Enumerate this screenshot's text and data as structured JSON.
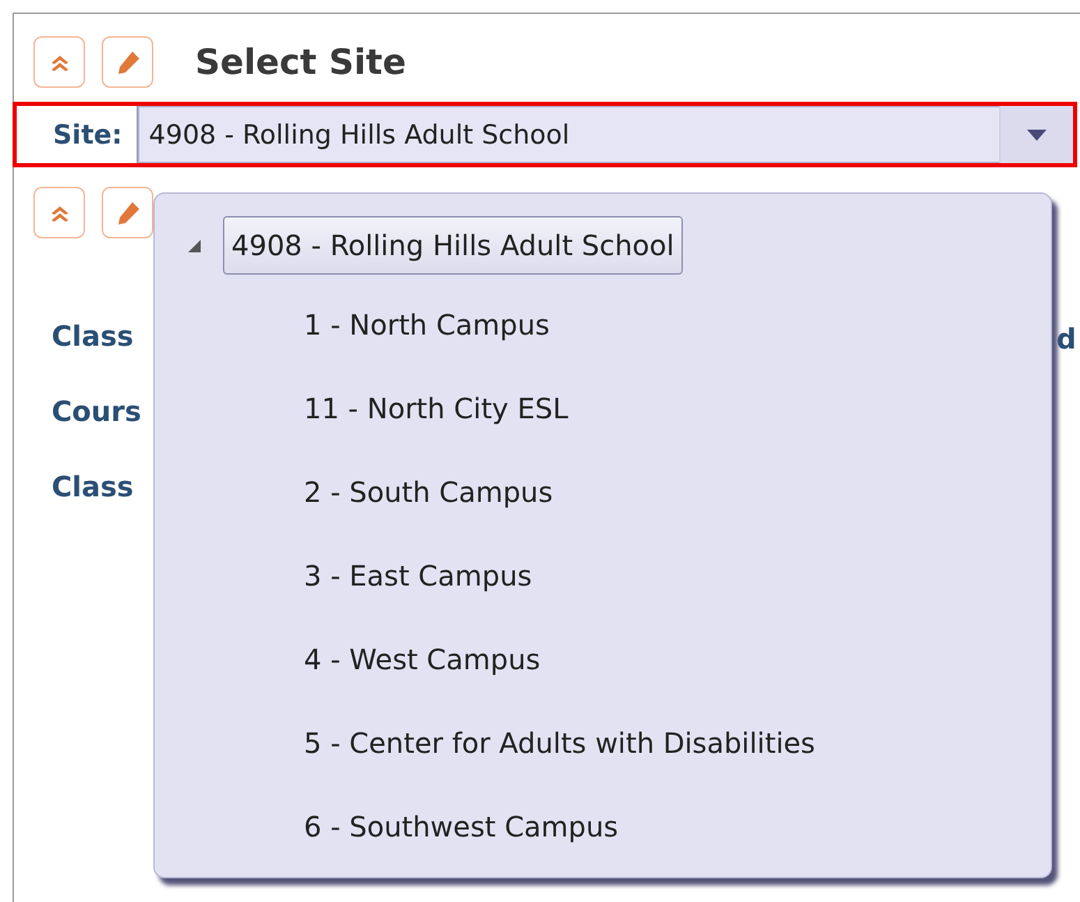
{
  "header": {
    "title": "Select Site"
  },
  "site_field": {
    "label": "Site:",
    "value": "4908 - Rolling Hills Adult School",
    "expanded": true
  },
  "background_labels": [
    "Class",
    "Cours",
    "Class"
  ],
  "background_right_text": "d",
  "dropdown": {
    "root": {
      "label": "4908 - Rolling Hills Adult School",
      "expanded": true,
      "selected": true,
      "children": [
        {
          "label": "1 - North Campus",
          "selected": false
        },
        {
          "label": "11 - North City ESL",
          "selected": false
        },
        {
          "label": "2 - South Campus",
          "selected": false
        },
        {
          "label": "3 - East Campus",
          "selected": false
        },
        {
          "label": "4 - West Campus",
          "selected": false
        },
        {
          "label": "5 - Center for Adults with Disabilities",
          "selected": false
        },
        {
          "label": "6 - Southwest Campus",
          "selected": false
        }
      ]
    }
  }
}
